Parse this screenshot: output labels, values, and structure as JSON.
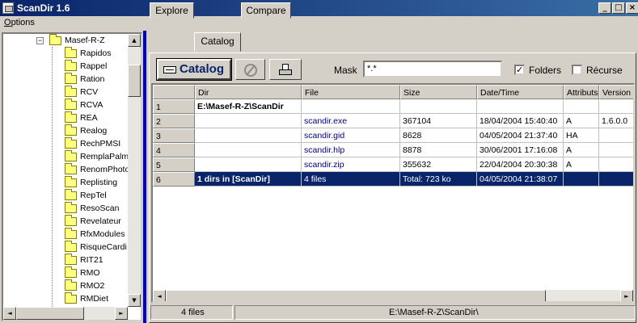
{
  "window": {
    "title": "ScanDir 1.6",
    "minimize": "_",
    "maximize": "□",
    "close": "×"
  },
  "menu": {
    "options": "Options"
  },
  "tree": {
    "parent": "Masef-R-Z",
    "expander": "−",
    "items": [
      "Rapidos",
      "Rappel",
      "Ration",
      "RCV",
      "RCVA",
      "REA",
      "Realog",
      "RechPMSI",
      "RemplaPalm",
      "RenomPhoto",
      "Replisting",
      "RepTel",
      "ResoScan",
      "Revelateur",
      "RfxModules",
      "RisqueCardi",
      "RIT21",
      "RMO",
      "RMO2",
      "RMDiet"
    ]
  },
  "tabs": [
    "Explore",
    "Catalog",
    "Compare"
  ],
  "toolbar": {
    "catalog_label": "Catalog",
    "mask_label": "Mask",
    "mask_value": "*.*",
    "folders_label": "Folders",
    "folders_checked": "✓",
    "recurse_label": "Récurse",
    "recurse_checked": ""
  },
  "grid": {
    "columns": [
      "",
      "Dir",
      "File",
      "Size",
      "Date/Time",
      "Attributs",
      "Version"
    ],
    "rows": [
      [
        "1",
        "E:\\Masef-R-Z\\ScanDir",
        "",
        "",
        "",
        "",
        ""
      ],
      [
        "2",
        "",
        "scandir.exe",
        "367104",
        "18/04/2004 15:40:40",
        "A",
        "1.6.0.0"
      ],
      [
        "3",
        "",
        "scandir.gid",
        "8628",
        "04/05/2004 21:37:40",
        "HA",
        ""
      ],
      [
        "4",
        "",
        "scandir.hlp",
        "8878",
        "30/06/2001 17:16:08",
        "A",
        ""
      ],
      [
        "5",
        "",
        "scandir.zip",
        "355632",
        "22/04/2004 20:30:38",
        "A",
        ""
      ],
      [
        "6",
        "1 dirs in [ScanDir]",
        "4 files",
        "Total: 723 ko",
        "04/05/2004 21:38:07",
        "",
        ""
      ]
    ],
    "selected_row": 6
  },
  "status": {
    "count": "4 files",
    "path": "E:\\Masef-R-Z\\ScanDir\\"
  },
  "scroll": {
    "left": "◄",
    "right": "►",
    "up": "▲",
    "down": "▼"
  }
}
